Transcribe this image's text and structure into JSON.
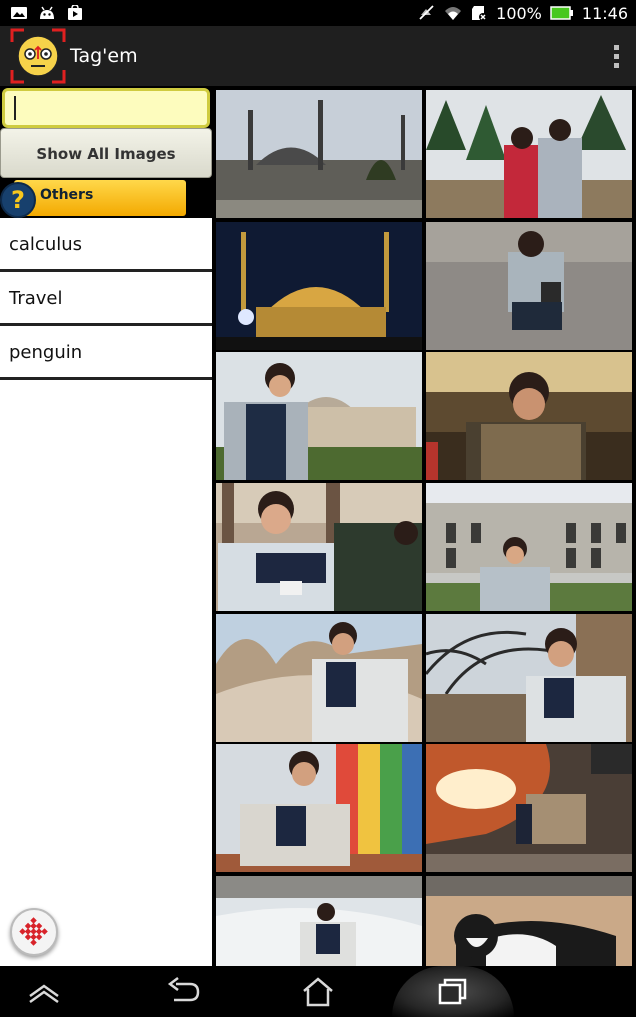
{
  "status_bar": {
    "battery": "100%",
    "time": "11:46",
    "left_icons": [
      "gallery-icon",
      "android-icon",
      "play-store-icon"
    ],
    "right_icons": [
      "muted-icon",
      "wifi-icon",
      "sd-card-icon",
      "battery-icon"
    ]
  },
  "app": {
    "title": "Tag'em",
    "logo": "tagem-face-logo",
    "menu_icon": "overflow-menu-icon"
  },
  "sidebar": {
    "search": {
      "value": "",
      "placeholder": ""
    },
    "show_all_label": "Show All Images",
    "others_label": "Others",
    "others_badge": "?",
    "tags": [
      {
        "label": "calculus"
      },
      {
        "label": "Travel"
      },
      {
        "label": "penguin"
      }
    ],
    "fab_icon": "grid-dots-icon"
  },
  "photos": [
    {
      "name": "photo-mosque-day"
    },
    {
      "name": "photo-couple-trees"
    },
    {
      "name": "photo-mosque-night"
    },
    {
      "name": "photo-crouching-stones"
    },
    {
      "name": "photo-man-mosque"
    },
    {
      "name": "photo-man-eating"
    },
    {
      "name": "photo-man-camera"
    },
    {
      "name": "photo-man-courtyard"
    },
    {
      "name": "photo-man-cappadocia"
    },
    {
      "name": "photo-man-tree"
    },
    {
      "name": "photo-man-balloon"
    },
    {
      "name": "photo-balloon-burner"
    },
    {
      "name": "photo-man-travertine"
    },
    {
      "name": "photo-cat"
    }
  ],
  "nav_bar": {
    "icons": [
      "nav-up-icon",
      "back-icon",
      "home-icon",
      "recents-icon"
    ]
  },
  "colors": {
    "search_bg": "#fdfcbe",
    "others_pill": "#f3a900",
    "action_bar": "#1f1f1f"
  }
}
